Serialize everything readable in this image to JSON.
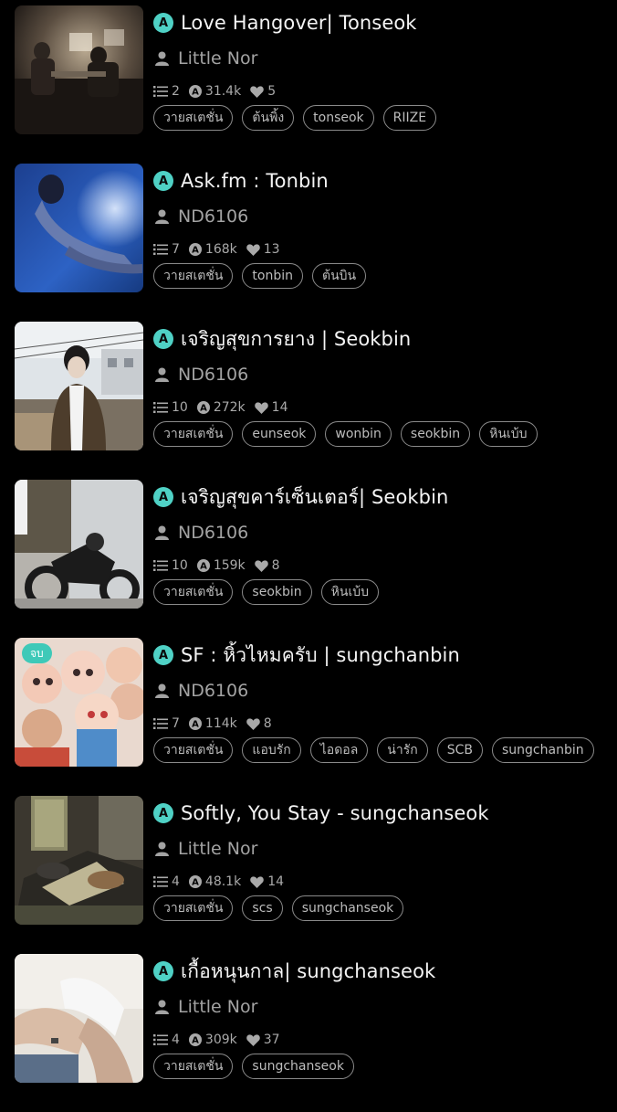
{
  "stories": [
    {
      "title": "Love Hangover| Tonseok",
      "author": "Little Nor",
      "chapters": "2",
      "reads": "31.4k",
      "likes": "5",
      "tags": [
        "วายสเตชั่น",
        "ต้นพิ้ง",
        "tonseok",
        "RIIZE"
      ],
      "badge": null
    },
    {
      "title": "Ask.fm : Tonbin",
      "author": "ND6106",
      "chapters": "7",
      "reads": "168k",
      "likes": "13",
      "tags": [
        "วายสเตชั่น",
        "tonbin",
        "ต้นบิน"
      ],
      "badge": null
    },
    {
      "title": "เจริญสุขการยาง | Seokbin",
      "author": "ND6106",
      "chapters": "10",
      "reads": "272k",
      "likes": "14",
      "tags": [
        "วายสเตชั่น",
        "eunseok",
        "wonbin",
        "seokbin",
        "หินเบ้บ"
      ],
      "badge": null
    },
    {
      "title": "เจริญสุขคาร์เซ็นเตอร์| Seokbin",
      "author": "ND6106",
      "chapters": "10",
      "reads": "159k",
      "likes": "8",
      "tags": [
        "วายสเตชั่น",
        "seokbin",
        "หินเบ้บ"
      ],
      "badge": null
    },
    {
      "title": "SF : หิ้วไหมครับ | sungchanbin",
      "author": "ND6106",
      "chapters": "7",
      "reads": "114k",
      "likes": "8",
      "tags": [
        "วายสเตชั่น",
        "แอบรัก",
        "ไอดอล",
        "น่ารัก",
        "SCB",
        "sungchanbin"
      ],
      "badge": "จบ"
    },
    {
      "title": "Softly, You Stay - sungchanseok",
      "author": "Little Nor",
      "chapters": "4",
      "reads": "48.1k",
      "likes": "14",
      "tags": [
        "วายสเตชั่น",
        "scs",
        "sungchanseok"
      ],
      "badge": null
    },
    {
      "title": "เกื้อหนุนกาล| sungchanseok",
      "author": "Little Nor",
      "chapters": "4",
      "reads": "309k",
      "likes": "37",
      "tags": [
        "วายสเตชั่น",
        "sungchanseok"
      ],
      "badge": null
    }
  ],
  "icons": {
    "author": "person-icon",
    "chapters": "list-icon",
    "reads": "reads-icon",
    "likes": "heart-icon",
    "story_type": "a-badge-icon"
  },
  "a_badge_letter": "A",
  "colors": {
    "accent": "#4fd1c5",
    "background": "#000000",
    "tag_border": "#8a8a8a",
    "muted_text": "#a3a3a3"
  }
}
